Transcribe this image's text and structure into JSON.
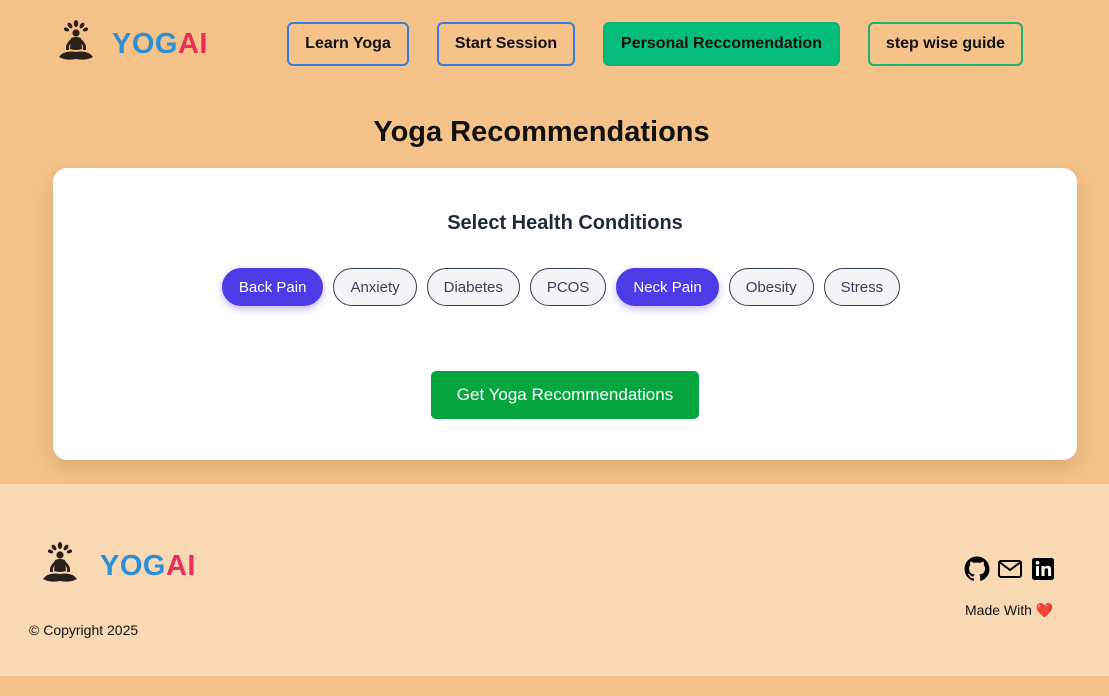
{
  "header": {
    "logo": {
      "text_part1": "YOG",
      "text_part2": "AI",
      "icon": "meditation-icon"
    },
    "nav": {
      "learn_yoga": "Learn Yoga",
      "start_session": "Start Session",
      "personal_recommendation": "Personal Reccomendation",
      "step_wise_guide": "step wise guide"
    },
    "active_nav": "personal_recommendation"
  },
  "main": {
    "title": "Yoga Recommendations",
    "card": {
      "heading": "Select Health Conditions",
      "conditions": [
        {
          "label": "Back Pain",
          "selected": true
        },
        {
          "label": "Anxiety",
          "selected": false
        },
        {
          "label": "Diabetes",
          "selected": false
        },
        {
          "label": "PCOS",
          "selected": false
        },
        {
          "label": "Neck Pain",
          "selected": true
        },
        {
          "label": "Obesity",
          "selected": false
        },
        {
          "label": "Stress",
          "selected": false
        }
      ],
      "submit_label": "Get Yoga Recommendations"
    }
  },
  "footer": {
    "logo": {
      "text_part1": "YOG",
      "text_part2": "AI",
      "icon": "meditation-icon"
    },
    "copyright": "© Copyright 2025",
    "made_with": "Made With",
    "heart": "❤️",
    "socials": [
      "github-icon",
      "mail-icon",
      "linkedin-icon"
    ]
  },
  "colors": {
    "page_bg": "#f5c389",
    "footer_bg": "#f8d9b4",
    "logo_blue": "#2b8fd6",
    "logo_pink": "#e8305e",
    "active_nav": "#06bd7c",
    "chip_selected": "#4f3ae8",
    "cta": "#05a63f"
  }
}
